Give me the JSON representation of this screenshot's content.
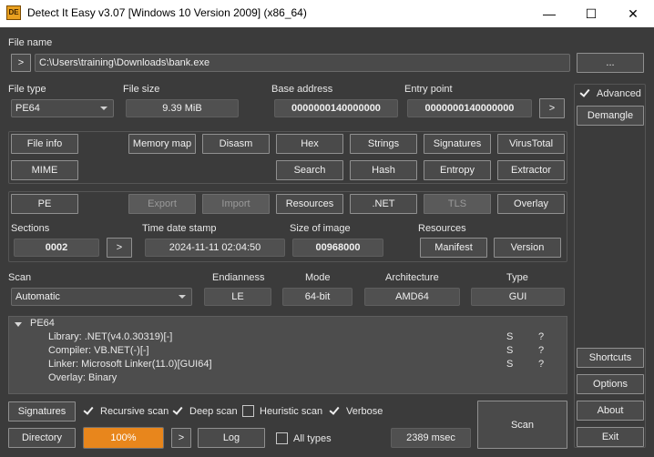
{
  "window": {
    "title": "Detect It Easy v3.07 [Windows 10 Version 2009] (x86_64)",
    "icon_text": "DE",
    "minimize": "—",
    "maximize": "☐",
    "close": "✕"
  },
  "file": {
    "label": "File name",
    "arrow": ">",
    "path": "C:\\Users\\training\\Downloads\\bank.exe",
    "browse": "..."
  },
  "info": {
    "file_type_label": "File type",
    "file_type_value": "PE64",
    "file_size_label": "File size",
    "file_size_value": "9.39 MiB",
    "base_address_label": "Base address",
    "base_address_value": "0000000140000000",
    "entry_point_label": "Entry point",
    "entry_point_value": "0000000140000000",
    "entry_arrow": ">"
  },
  "tools": {
    "file_info": "File info",
    "mime": "MIME",
    "memory_map": "Memory map",
    "disasm": "Disasm",
    "hex": "Hex",
    "strings": "Strings",
    "signatures": "Signatures",
    "virustotal": "VirusTotal",
    "search": "Search",
    "hash": "Hash",
    "entropy": "Entropy",
    "extractor": "Extractor"
  },
  "pe": {
    "pe": "PE",
    "export": "Export",
    "import": "Import",
    "resources": "Resources",
    "net": ".NET",
    "tls": "TLS",
    "overlay": "Overlay",
    "sections_label": "Sections",
    "sections_value": "0002",
    "sections_arrow": ">",
    "timestamp_label": "Time date stamp",
    "timestamp_value": "2024-11-11 02:04:50",
    "image_size_label": "Size of image",
    "image_size_value": "00968000",
    "resources_label": "Resources",
    "manifest": "Manifest",
    "version": "Version"
  },
  "scan": {
    "scan_label": "Scan",
    "scan_value": "Automatic",
    "endianness_label": "Endianness",
    "endianness_value": "LE",
    "mode_label": "Mode",
    "mode_value": "64-bit",
    "architecture_label": "Architecture",
    "architecture_value": "AMD64",
    "type_label": "Type",
    "type_value": "GUI"
  },
  "results": {
    "root": "PE64",
    "items": [
      {
        "text": "Library: .NET(v4.0.30319)[-]",
        "s": "S",
        "q": "?"
      },
      {
        "text": "Compiler: VB.NET(-)[-]",
        "s": "S",
        "q": "?"
      },
      {
        "text": "Linker: Microsoft Linker(11.0)[GUI64]",
        "s": "S",
        "q": "?"
      },
      {
        "text": "Overlay: Binary",
        "s": "",
        "q": ""
      }
    ]
  },
  "side": {
    "advanced": "Advanced",
    "demangle": "Demangle",
    "shortcuts": "Shortcuts",
    "options": "Options",
    "about": "About",
    "exit": "Exit"
  },
  "bottom": {
    "signatures": "Signatures",
    "recursive": "Recursive scan",
    "deep": "Deep scan",
    "heuristic": "Heuristic scan",
    "verbose": "Verbose",
    "directory": "Directory",
    "progress_text": "100%",
    "progress_value": 1.0,
    "arrow": ">",
    "log": "Log",
    "all_types": "All types",
    "time": "2389 msec",
    "scan": "Scan"
  },
  "colors": {
    "background": "#3b3b3b",
    "progress": "#e8861c",
    "titlebar": "#ffffff"
  }
}
